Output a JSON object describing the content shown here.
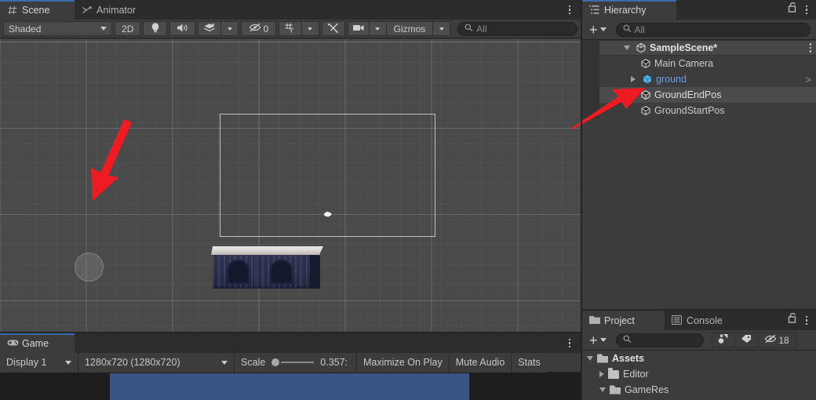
{
  "app": {
    "name": "Unity Editor",
    "accent_color": "#3b6ea8"
  },
  "scene_panel": {
    "tabs": [
      {
        "label": "Scene",
        "icon": "grid-hash-icon",
        "active": true
      },
      {
        "label": "Animator",
        "icon": "animator-icon",
        "active": false
      }
    ],
    "menu_icon": "kebab-menu-icon",
    "toolbar": {
      "shading_mode": "Shaded",
      "twod_toggle": "2D",
      "lighting_icon": "lightbulb-icon",
      "audio_icon": "speaker-icon",
      "fx_icon": "effects-layers-icon",
      "hidden_objects_icon": "hidden-eye-icon",
      "hidden_objects_count": "0",
      "gizmo_grid_icon": "grid-axis-y-icon",
      "tools_icon": "tools-wrench-icon",
      "camera_icon": "camera-icon",
      "gizmos_label": "Gizmos",
      "search_placeholder": "All",
      "search_value": "",
      "search_icon": "search-icon"
    },
    "viewport": {
      "objects": [
        {
          "name": "camera-frustum-rect"
        },
        {
          "name": "scene-origin-gizmo"
        },
        {
          "name": "sphere-collider-gizmo"
        },
        {
          "name": "ground-building-mesh"
        }
      ]
    }
  },
  "annotations": [
    {
      "name": "arrow-to-sphere-gizmo",
      "color": "#ee1c22",
      "direction": "down-left"
    },
    {
      "name": "arrow-to-groundendpos",
      "color": "#ee1c22",
      "direction": "up-right"
    }
  ],
  "game_panel": {
    "tabs": [
      {
        "label": "Game",
        "icon": "gamepad-icon",
        "active": true
      }
    ],
    "menu_icon": "kebab-menu-icon",
    "toolbar": {
      "display": "Display 1",
      "resolution": "1280x720 (1280x720)",
      "scale_label": "Scale",
      "scale_value": "0.357:",
      "maximize_on_play": "Maximize On Play",
      "mute_audio": "Mute Audio",
      "stats": "Stats"
    },
    "render_color": "#3a5585"
  },
  "hierarchy_panel": {
    "tabs": [
      {
        "label": "Hierarchy",
        "icon": "hierarchy-list-icon",
        "active": true
      }
    ],
    "lock_icon": "padlock-open-icon",
    "menu_icon": "kebab-menu-icon",
    "toolbar": {
      "add_label": "+",
      "search_placeholder": "All",
      "search_value": "",
      "search_icon": "search-icon"
    },
    "rows": [
      {
        "label": "SampleScene*",
        "icon": "unity-scene-icon",
        "depth": 0,
        "twisty": "down",
        "selected": false,
        "is_scene": true,
        "has_menu": true,
        "color": "#e4e4e4"
      },
      {
        "label": "Main Camera",
        "icon": "cube-icon",
        "depth": 1,
        "twisty": "none",
        "selected": false,
        "is_scene": false,
        "has_menu": false,
        "color": "#cbcbcb"
      },
      {
        "label": "ground",
        "icon": "prefab-cube-icon",
        "depth": 1,
        "twisty": "right",
        "selected": false,
        "is_scene": false,
        "has_menu": false,
        "color": "#6d9eeb",
        "chevron": ">"
      },
      {
        "label": "GroundEndPos",
        "icon": "cube-icon",
        "depth": 1,
        "twisty": "none",
        "selected": true,
        "is_scene": false,
        "has_menu": false,
        "color": "#dcdcdc"
      },
      {
        "label": "GroundStartPos",
        "icon": "cube-icon",
        "depth": 1,
        "twisty": "none",
        "selected": false,
        "is_scene": false,
        "has_menu": false,
        "color": "#cbcbcb"
      }
    ]
  },
  "project_panel": {
    "tabs": [
      {
        "label": "Project",
        "icon": "folder-icon",
        "active": true
      },
      {
        "label": "Console",
        "icon": "console-lines-icon",
        "active": false
      }
    ],
    "lock_icon": "padlock-open-icon",
    "menu_icon": "kebab-menu-icon",
    "toolbar": {
      "add_label": "+",
      "search_placeholder": "",
      "search_value": "",
      "search_icon": "search-icon",
      "filter_type_icon": "object-filter-icon",
      "filter_label_icon": "tag-icon",
      "hidden_icon": "hidden-eye-icon",
      "hidden_count": "18"
    },
    "rows": [
      {
        "label": "Assets",
        "depth": 0,
        "twisty": "down",
        "folder": "open",
        "bold": true
      },
      {
        "label": "Editor",
        "depth": 1,
        "twisty": "right",
        "folder": "closed",
        "bold": false
      },
      {
        "label": "GameRes",
        "depth": 1,
        "twisty": "down",
        "folder": "open",
        "bold": false
      }
    ]
  }
}
